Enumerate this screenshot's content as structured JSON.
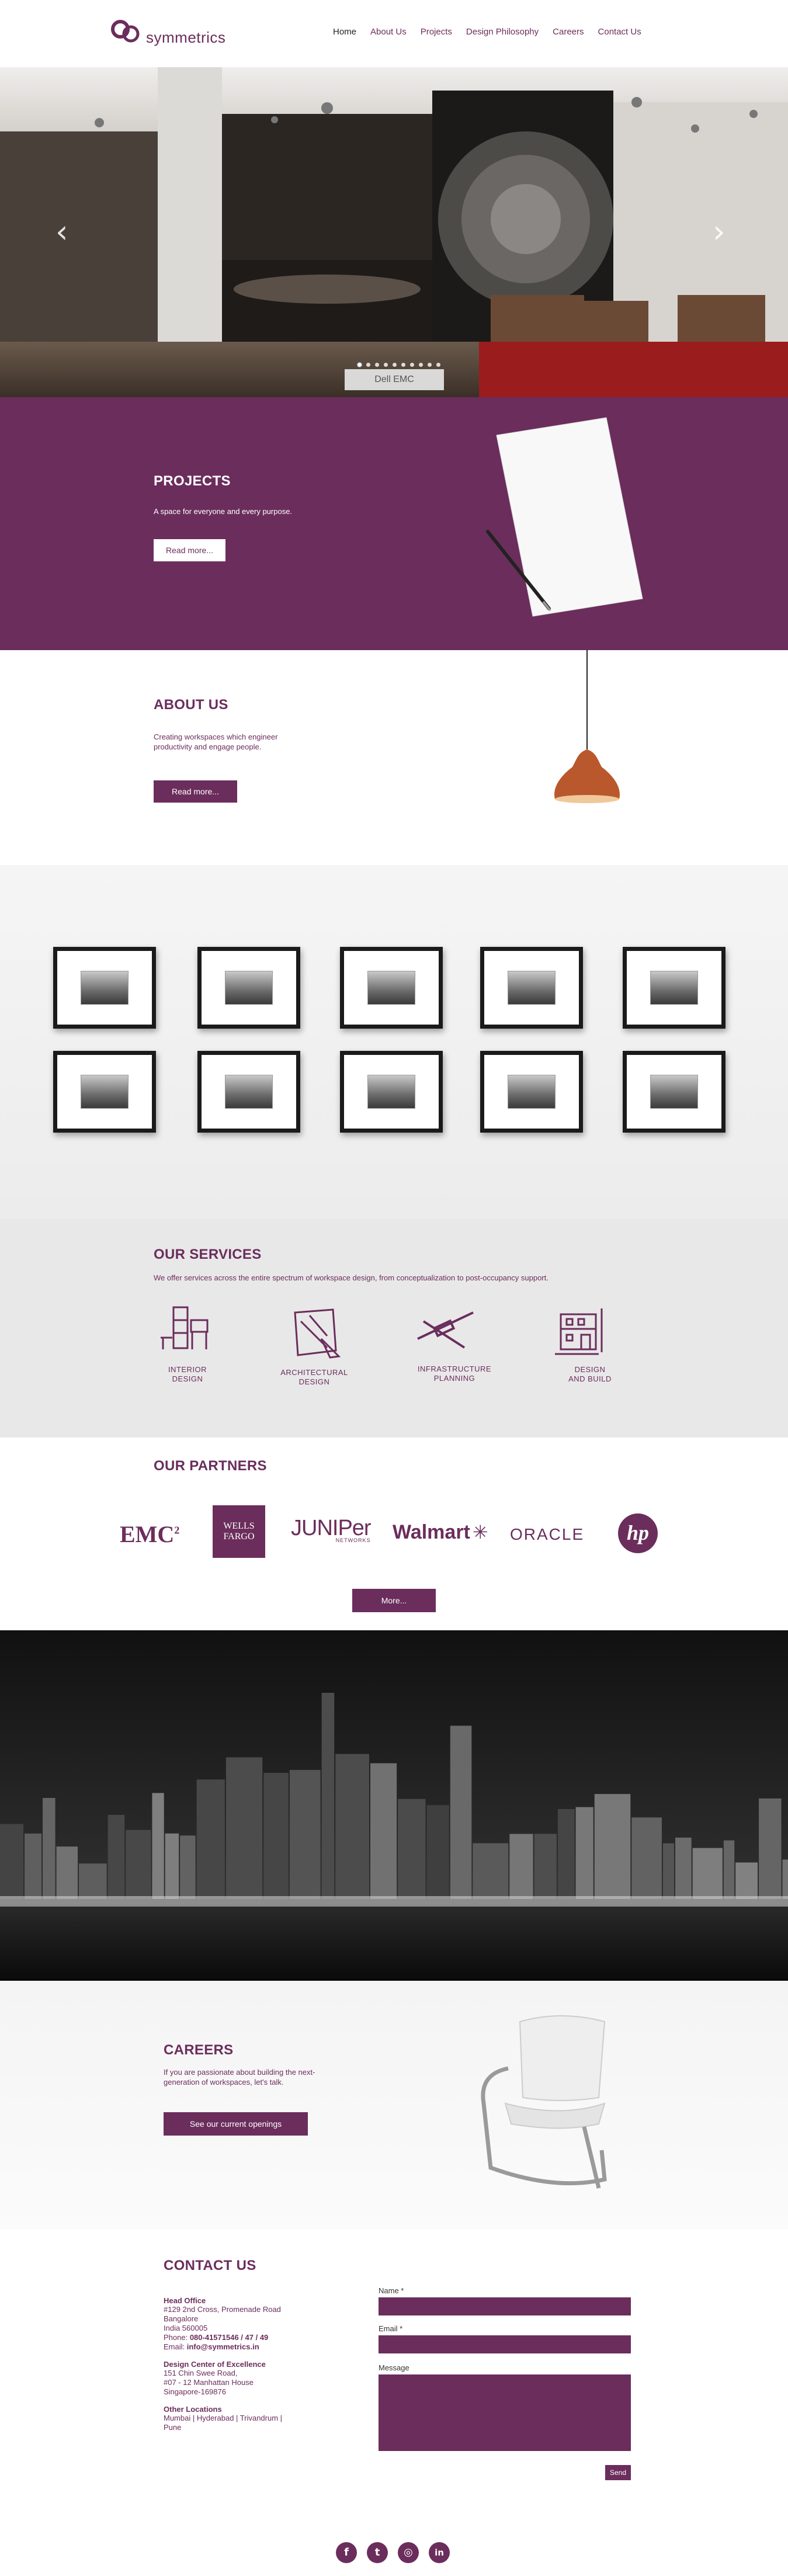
{
  "header": {
    "logo_text": "symmetrics",
    "nav": [
      "Home",
      "About Us",
      "Projects",
      "Design Philosophy",
      "Careers",
      "Contact Us"
    ]
  },
  "hero": {
    "caption": "Dell EMC",
    "slide_count": 10,
    "active_slide": 0
  },
  "projects": {
    "title": "PROJECTS",
    "text": "A space for everyone and every purpose.",
    "button": "Read more..."
  },
  "about": {
    "title": "ABOUT US",
    "text1": "Creating workspaces which engineer",
    "text2": "productivity and engage people.",
    "button": "Read more..."
  },
  "services": {
    "title": "OUR SERVICES",
    "text": "We offer services across the entire spectrum of workspace design, from conceptualization to post-occupancy support.",
    "items": [
      {
        "line1": "INTERIOR",
        "line2": "DESIGN"
      },
      {
        "line1": "ARCHITECTURAL",
        "line2": "DESIGN"
      },
      {
        "line1": "INFRASTRUCTURE",
        "line2": "PLANNING"
      },
      {
        "line1": "DESIGN",
        "line2": "AND BUILD"
      }
    ]
  },
  "partners": {
    "title": "OUR PARTNERS",
    "emc": "EMC",
    "emc_sup": "2",
    "wells1": "WELLS",
    "wells2": "FARGO",
    "juniper": "JUNIPer",
    "juniper_sub": "NETWORKS",
    "walmart": "Walmart",
    "oracle": "ORACLE",
    "hp": "hp",
    "button": "More..."
  },
  "careers": {
    "title": "CAREERS",
    "text1": "If you are passionate about building the next-",
    "text2": "generation of workspaces, let's talk.",
    "button": "See our current openings"
  },
  "contact": {
    "title": "CONTACT US",
    "head_office": "Head Office",
    "ho_lines": [
      "#129 2nd Cross, Promenade Road",
      "Bangalore",
      "India 560005"
    ],
    "phone_label": "Phone: ",
    "phone": "080-41571546 / 47 / 49",
    "email_label": "Email: ",
    "email": "info@symmetrics.in",
    "dce": "Design Center of Excellence",
    "dce_lines": [
      "151 Chin Swee Road,",
      "#07 - 12 Manhattan House",
      "Singapore-169876"
    ],
    "other": "Other Locations",
    "other_line1": "Mumbai  |  Hyderabad  |  Trivandrum  |",
    "other_line2": "Pune",
    "form": {
      "name": "Name *",
      "email": "Email *",
      "message": "Message",
      "send": "Send"
    }
  },
  "social": {
    "icons": [
      "facebook-icon",
      "twitter-icon",
      "instagram-icon",
      "linkedin-icon"
    ],
    "glyphs": [
      "f",
      "t",
      "◎",
      "in"
    ]
  },
  "colors": {
    "brand": "#6b2d5c"
  }
}
